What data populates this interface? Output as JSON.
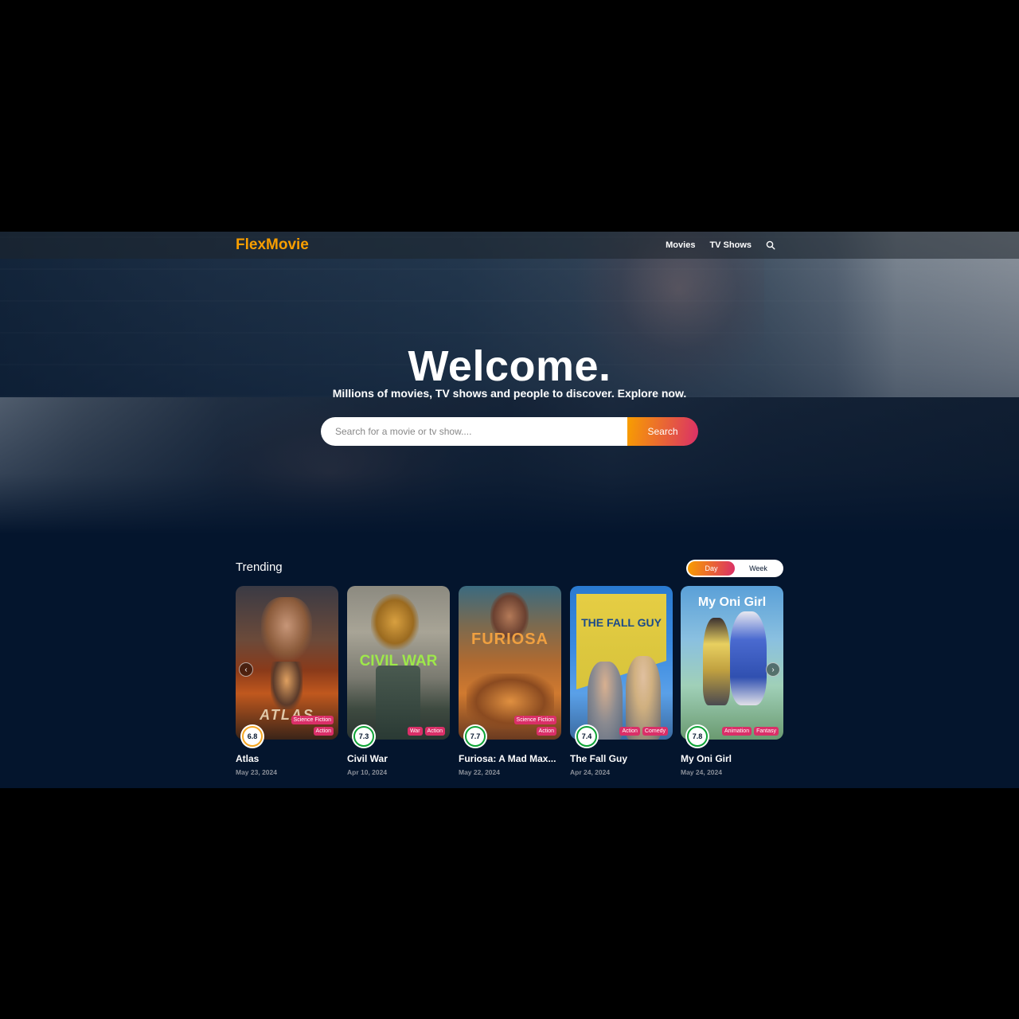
{
  "header": {
    "logo": "FlexMovie",
    "nav": [
      "Movies",
      "TV Shows"
    ],
    "search_icon": "search-icon"
  },
  "hero": {
    "title": "Welcome.",
    "subtitle": "Millions of movies, TV shows and people to discover. Explore now.",
    "search_placeholder": "Search for a movie or tv show....",
    "search_button": "Search"
  },
  "trending": {
    "title": "Trending",
    "tabs": [
      "Day",
      "Week"
    ],
    "active_tab": "Day",
    "cards": [
      {
        "title": "Atlas",
        "date": "May 23, 2024",
        "rating": "6.8",
        "rating_color": "#f5a623",
        "genres": [
          "Science Fiction",
          "Action"
        ],
        "poster_text": "ATLAS"
      },
      {
        "title": "Civil War",
        "date": "Apr 10, 2024",
        "rating": "7.3",
        "rating_color": "#0fa336",
        "genres": [
          "War",
          "Action"
        ],
        "poster_text": "CIVIL WAR"
      },
      {
        "title": "Furiosa: A Mad Max...",
        "date": "May 22, 2024",
        "rating": "7.7",
        "rating_color": "#0fa336",
        "genres": [
          "Science Fiction",
          "Action"
        ],
        "poster_text": "FURIOSA"
      },
      {
        "title": "The Fall Guy",
        "date": "Apr 24, 2024",
        "rating": "7.4",
        "rating_color": "#0fa336",
        "genres": [
          "Action",
          "Comedy"
        ],
        "poster_text": "THE FALL GUY"
      },
      {
        "title": "My Oni Girl",
        "date": "May 24, 2024",
        "rating": "7.8",
        "rating_color": "#0fa336",
        "genres": [
          "Animation",
          "Fantasy"
        ],
        "poster_text": "My Oni Girl"
      }
    ]
  },
  "colors": {
    "background": "#04152d",
    "accent_orange": "#f89e00",
    "accent_pink": "#da2f68"
  }
}
